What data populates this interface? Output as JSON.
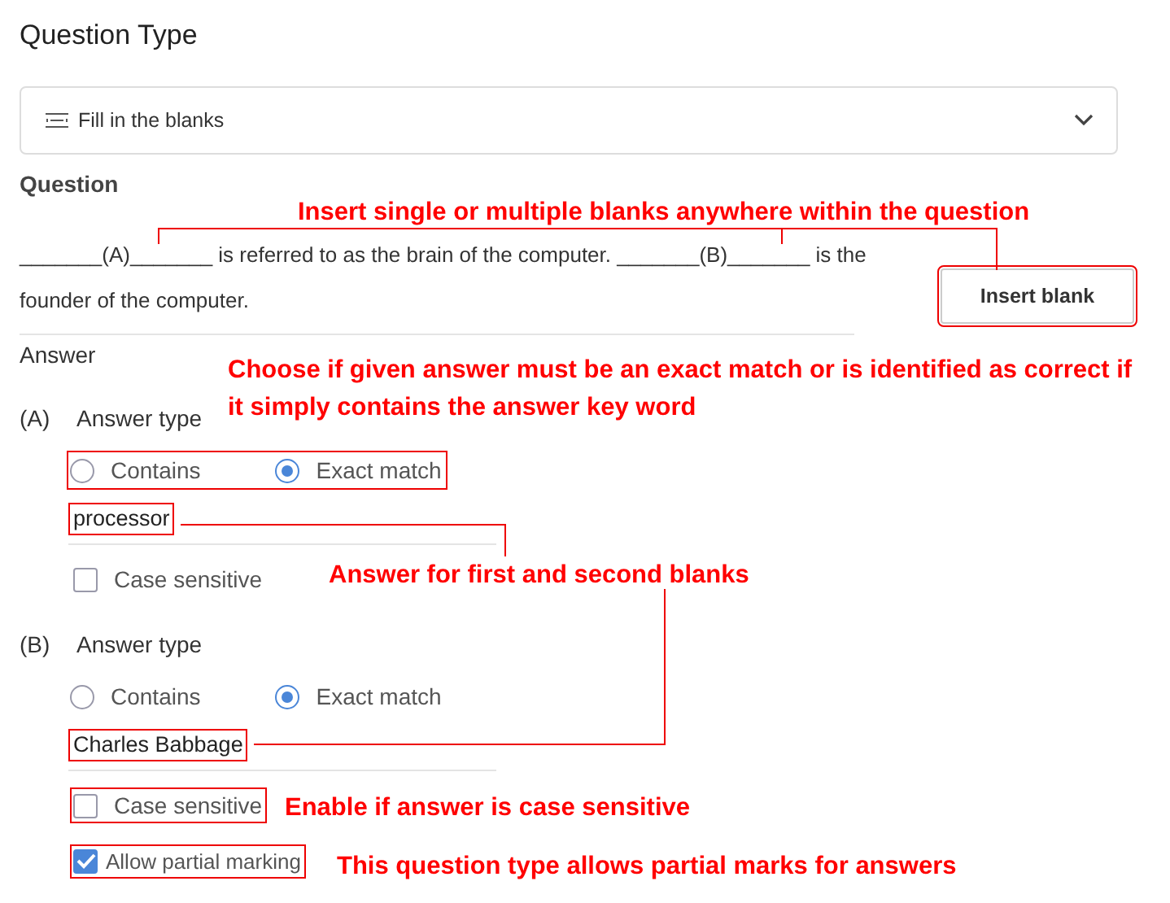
{
  "question_type": {
    "heading": "Question Type",
    "value": "Fill in the blanks"
  },
  "question": {
    "heading": "Question",
    "text": "_______(A)_______ is referred to as the brain of the computer.  _______(B)_______ is the founder of the computer.",
    "insert_button": {
      "label": "Insert blank",
      "highlighted": true
    }
  },
  "answer": {
    "heading": "Answer",
    "blanks": [
      {
        "label": "(A)",
        "type_label": "Answer type",
        "options_highlighted": true,
        "options": [
          {
            "label": "Contains",
            "selected": false
          },
          {
            "label": "Exact match",
            "selected": true
          }
        ],
        "value": "processor",
        "value_highlighted": true,
        "case_sensitive": {
          "label": "Case sensitive",
          "checked": false,
          "highlighted": false
        }
      },
      {
        "label": "(B)",
        "type_label": "Answer type",
        "options_highlighted": false,
        "options": [
          {
            "label": "Contains",
            "selected": false
          },
          {
            "label": "Exact match",
            "selected": true
          }
        ],
        "value": "Charles Babbage",
        "value_highlighted": true,
        "case_sensitive": {
          "label": "Case sensitive",
          "checked": false,
          "highlighted": true
        }
      }
    ]
  },
  "allow_partial": {
    "label": "Allow partial marking",
    "checked": true,
    "highlighted": true
  },
  "annotations": [
    {
      "text": "Insert single or multiple blanks anywhere within the question"
    },
    {
      "text": "Choose if given answer must be an exact match or is identified as correct if it simply contains the answer key word"
    },
    {
      "text": "Answer for first and second blanks"
    },
    {
      "text": "Enable if answer is case sensitive"
    },
    {
      "text": "This question type allows partial marks for answers"
    }
  ]
}
